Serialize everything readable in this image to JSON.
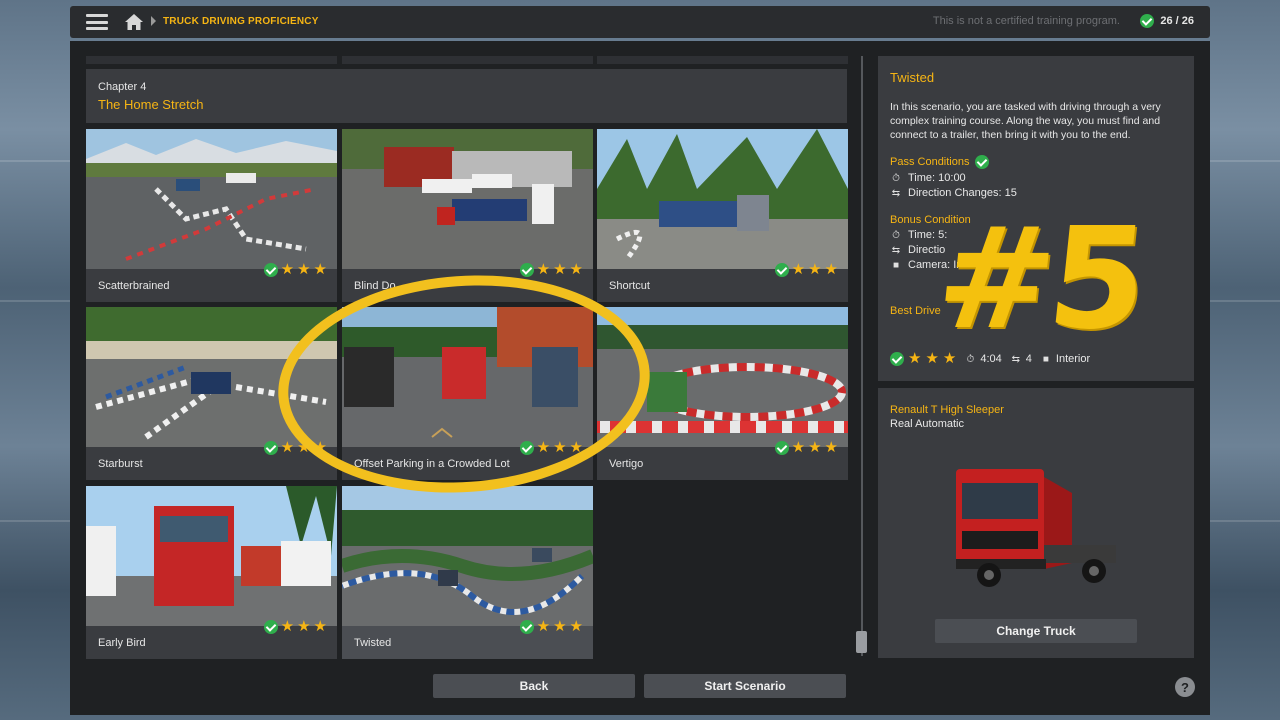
{
  "app": {
    "breadcrumb": "TRUCK DRIVING PROFICIENCY",
    "disclaimer": "This is not a certified training program.",
    "progress": "26 / 26",
    "menu_icon": "hamburger-menu-icon",
    "home_icon": "home-icon"
  },
  "chapter": {
    "number": "Chapter 4",
    "title": "The Home Stretch"
  },
  "scenarios": [
    {
      "name": "Scatterbrained",
      "completed": true,
      "stars": 3
    },
    {
      "name": "Blind Do",
      "completed": true,
      "stars": 3
    },
    {
      "name": "Shortcut",
      "completed": true,
      "stars": 3
    },
    {
      "name": "Starburst",
      "completed": true,
      "stars": 3
    },
    {
      "name": "Offset Parking in a Crowded Lot",
      "completed": true,
      "stars": 3
    },
    {
      "name": "Vertigo",
      "completed": true,
      "stars": 3
    },
    {
      "name": "Early Bird",
      "completed": true,
      "stars": 3
    },
    {
      "name": "Twisted",
      "completed": true,
      "stars": 3,
      "selected": true
    }
  ],
  "details": {
    "title": "Twisted",
    "description": "In this scenario, you are tasked with driving through a very complex training course. Along the way, you must find and connect to a trailer, then bring it with you to the end.",
    "pass_conditions_label": "Pass Conditions",
    "pass_time": "Time: 10:00",
    "pass_direction_changes": "Direction Changes: 15",
    "bonus_conditions_label": "Bonus Condition",
    "bonus_time": "Time: 5:",
    "bonus_direction": "Directio",
    "bonus_camera": "Camera: Int",
    "best_drive_label": "Best Drive",
    "best_time": "4:04",
    "best_direction_changes": "4",
    "best_camera": "Interior"
  },
  "truck": {
    "name": "Renault T High Sleeper",
    "transmission": "Real Automatic",
    "change_button": "Change Truck"
  },
  "buttons": {
    "back": "Back",
    "start": "Start Scenario",
    "help": "?"
  },
  "overlay": {
    "episode_number": "#5"
  },
  "colors": {
    "accent": "#f6b514",
    "check": "#2fae4c",
    "panel": "#3a3c40",
    "background": "#1f2123"
  }
}
